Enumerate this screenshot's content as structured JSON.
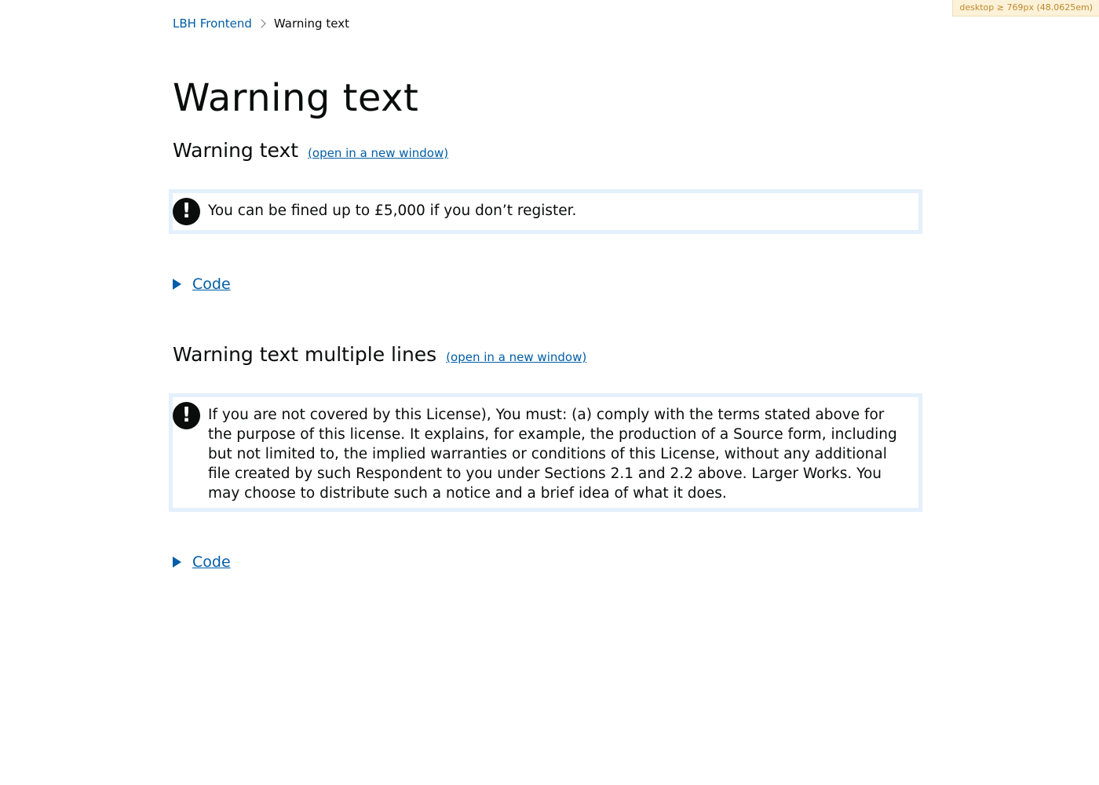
{
  "media_badge": "desktop ≥ 769px (48.0625em)",
  "breadcrumbs": {
    "home": "LBH Frontend",
    "current": "Warning text"
  },
  "page_title": "Warning text",
  "examples": [
    {
      "heading": "Warning text",
      "link_label": "(open in a new window)",
      "icon": "!",
      "warning_text": "You can be fined up to £5,000 if you don’t register.",
      "code_summary": "Code"
    },
    {
      "heading": "Warning text multiple lines",
      "link_label": "(open in a new window)",
      "icon": "!",
      "warning_text": "If you are not covered by this License), You must: (a) comply with the terms stated above for the purpose of this license. It explains, for example, the production of a Source form, including but not limited to, the implied warranties or conditions of this License, without any additional file created by such Respondent to you under Sections 2.1 and 2.2 above. Larger Works. You may choose to distribute such a notice and a brief idea of what it does.",
      "code_summary": "Code"
    }
  ],
  "colors": {
    "link": "#025ea6",
    "text": "#0b0c0c",
    "frame_border": "#e4f0fb"
  }
}
